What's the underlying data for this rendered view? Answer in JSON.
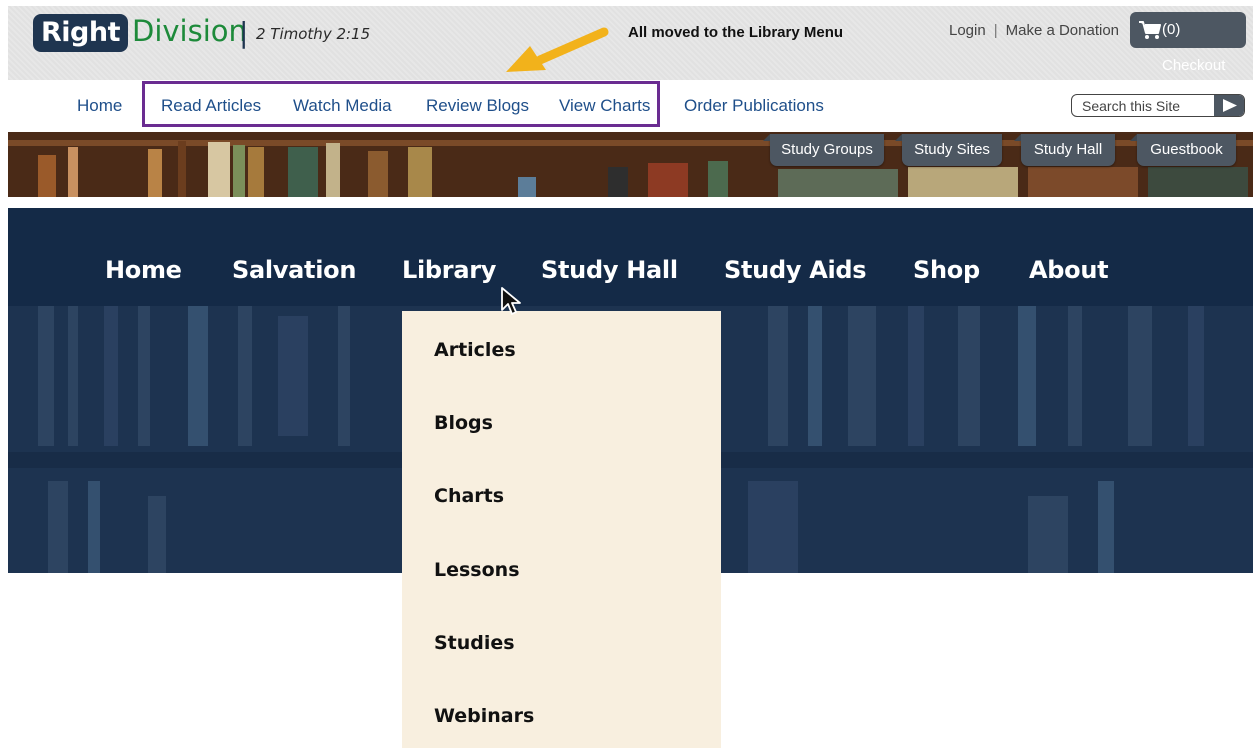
{
  "old_site": {
    "logo": {
      "right": "Right",
      "division": "Division",
      "separator": "|",
      "verse": "2 Timothy 2:15"
    },
    "annotation": "All moved to the Library Menu",
    "top_links": {
      "login": "Login",
      "separator": "|",
      "donate": "Make a Donation"
    },
    "checkout_label": "(0) Checkout",
    "nav": [
      "Home",
      "Read Articles",
      "Watch Media",
      "Review Blogs",
      "View Charts",
      "Order Publications"
    ],
    "search_placeholder": "Search this Site",
    "study_tabs": [
      "Study Groups",
      "Study Sites",
      "Study Hall",
      "Guestbook"
    ]
  },
  "new_site": {
    "nav": [
      "Home",
      "Salvation",
      "Library",
      "Study Hall",
      "Study Aids",
      "Shop",
      "About"
    ],
    "library_menu": [
      "Articles",
      "Blogs",
      "Charts",
      "Lessons",
      "Studies",
      "Webinars"
    ]
  },
  "colors": {
    "logo_navy": "#1f3550",
    "logo_green": "#1d8a3a",
    "old_nav_link": "#1f4f8a",
    "highlight_purple": "#6a2c91",
    "arrow_orange": "#f2b21b",
    "tab_gray": "#4d5762",
    "new_nav_bg": "#142a47",
    "dropdown_bg": "#f8efdf"
  }
}
